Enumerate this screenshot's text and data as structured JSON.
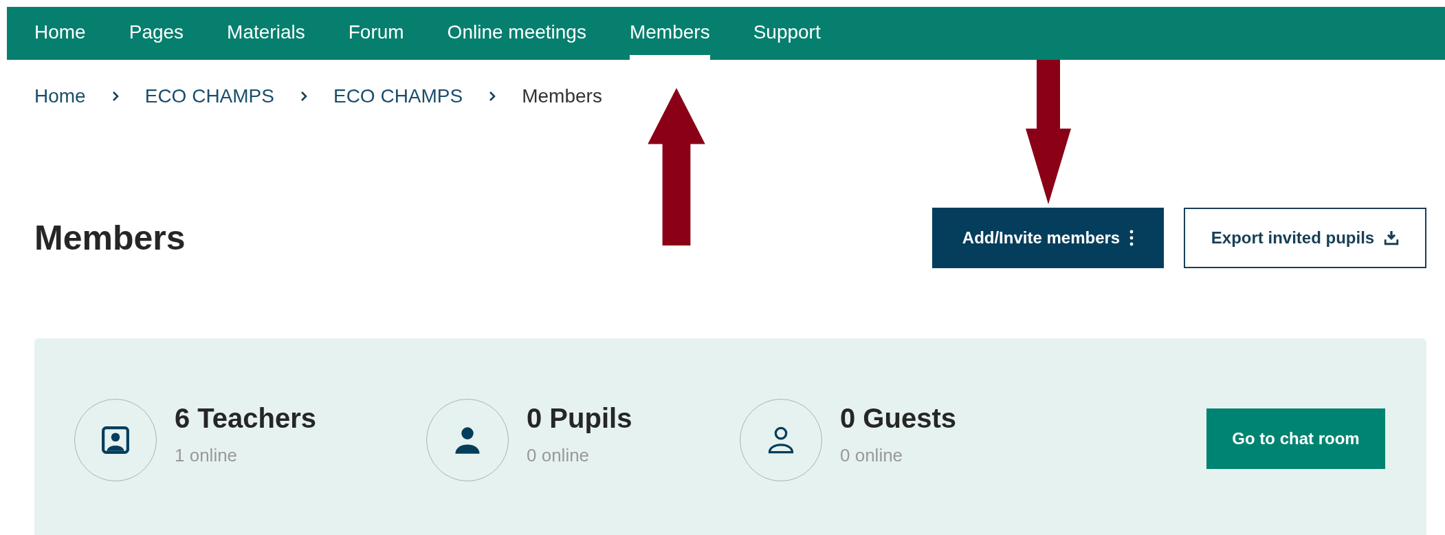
{
  "nav": [
    {
      "label": "Home",
      "selected": false
    },
    {
      "label": "Pages",
      "selected": false
    },
    {
      "label": "Materials",
      "selected": false
    },
    {
      "label": "Forum",
      "selected": false
    },
    {
      "label": "Online meetings",
      "selected": false
    },
    {
      "label": "Members",
      "selected": true
    },
    {
      "label": "Support",
      "selected": false
    }
  ],
  "breadcrumb": [
    "Home",
    "ECO CHAMPS",
    "ECO CHAMPS",
    "Members"
  ],
  "title": "Members",
  "actions": [
    {
      "label": "Add/Invite members",
      "kind": "menu"
    },
    {
      "label": "Export invited pupils",
      "kind": "export"
    }
  ],
  "stats": [
    {
      "kind": "teacher",
      "count": "6 Teachers",
      "online": "1 online"
    },
    {
      "kind": "pupil",
      "count": "0 Pupils",
      "online": "0 online"
    },
    {
      "kind": "guest",
      "count": "0 Guests",
      "online": "0 online"
    }
  ],
  "chat_button": "Go to chat room"
}
